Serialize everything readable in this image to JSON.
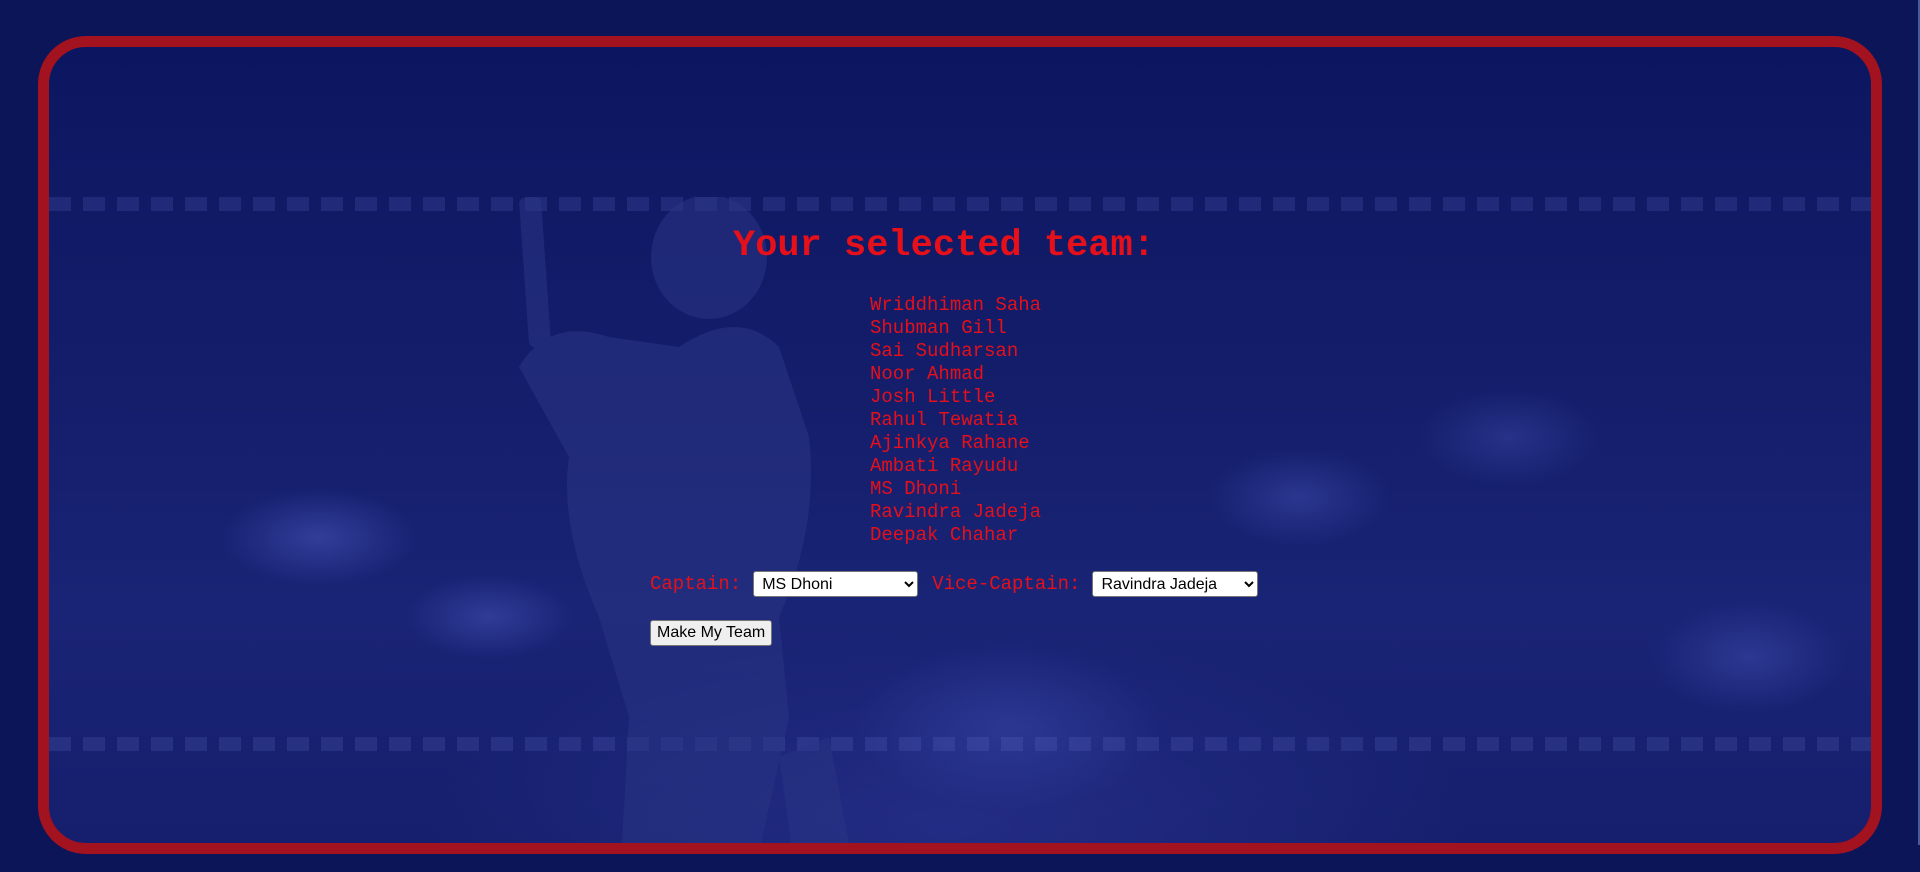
{
  "heading": "Your selected team:",
  "players": [
    "Wriddhiman Saha",
    "Shubman Gill",
    "Sai Sudharsan",
    "Noor Ahmad",
    "Josh Little",
    "Rahul Tewatia",
    "Ajinkya Rahane",
    "Ambati Rayudu",
    "MS Dhoni",
    "Ravindra Jadeja",
    "Deepak Chahar"
  ],
  "captain": {
    "label": "Captain:",
    "selected": "MS Dhoni"
  },
  "vice_captain": {
    "label": "Vice-Captain:",
    "selected": "Ravindra Jadeja"
  },
  "submit_label": "Make My Team",
  "colors": {
    "page_background": "#0b1557",
    "frame_border": "#a3121f",
    "text_accent": "#e5101a"
  }
}
